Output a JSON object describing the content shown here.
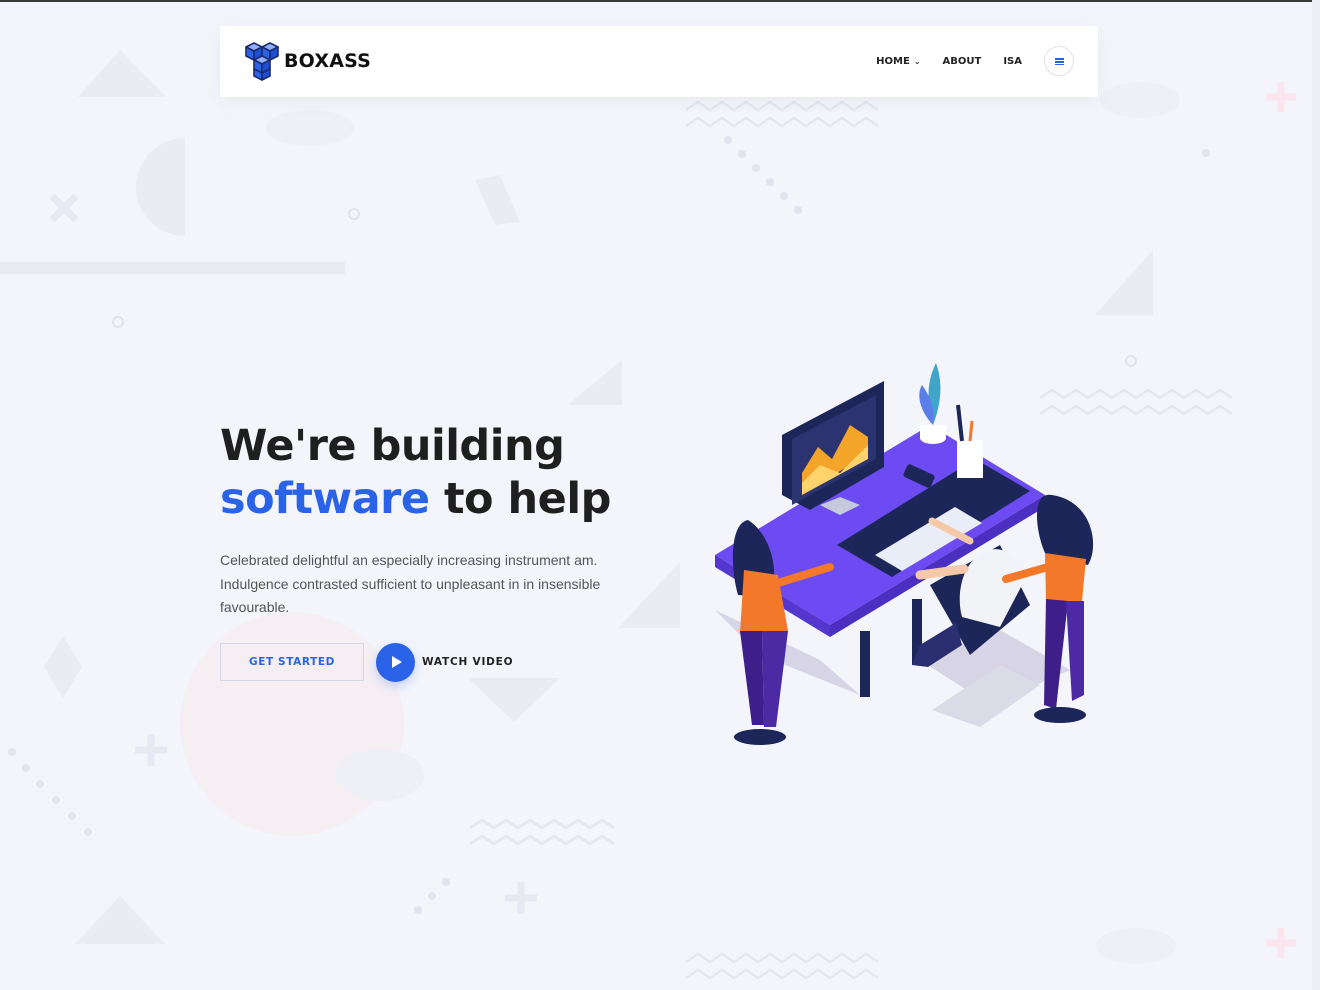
{
  "brand": {
    "name": "BOXASS",
    "logo_icon": "cube-stack-icon",
    "accent": "#2a63e8"
  },
  "nav": {
    "items": [
      {
        "label": "HOME",
        "has_dropdown": true
      },
      {
        "label": "ABOUT",
        "has_dropdown": false
      },
      {
        "label": "ISA",
        "has_dropdown": false
      }
    ],
    "menu_icon": "hamburger-menu-icon"
  },
  "hero": {
    "title_line1": "We're building",
    "title_accent": "software",
    "title_rest": " to help",
    "description": "Celebrated delightful an especially increasing instrument am. Indulgence contrasted sufficient to unpleasant in in insensible favourable.",
    "primary_button": "GET STARTED",
    "video_button": "WATCH VIDEO",
    "video_icon": "play-icon",
    "illustration": "isometric-office-team-illustration"
  },
  "colors": {
    "background": "#f3f5fa",
    "primary": "#2a63e8",
    "desk": "#6c4cf2",
    "orange": "#f3782a"
  }
}
